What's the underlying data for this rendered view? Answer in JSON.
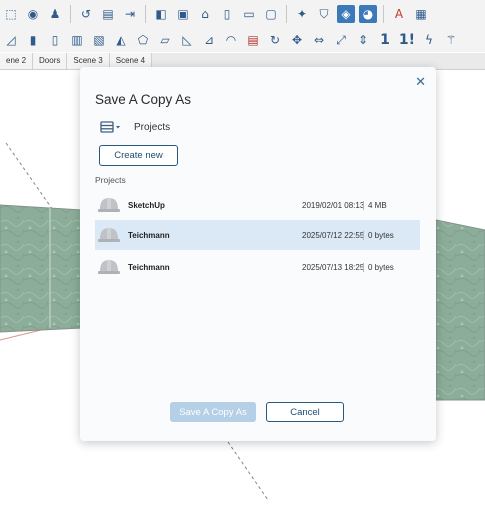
{
  "toolbar_top": {
    "icons": [
      "select-icon",
      "eye-icon",
      "walk-icon",
      "orbit-icon",
      "doc-icon",
      "arrow-icon",
      "cube-icon",
      "box-icon",
      "house-icon",
      "doc2-icon",
      "doc3-icon",
      "square-icon",
      "compass-icon",
      "shield-icon",
      "active-cube-icon",
      "active-cube2-icon",
      "text-icon",
      "swatch-icon"
    ]
  },
  "toolbar_second": {
    "icons": [
      "stair-icon",
      "door-icon",
      "door2-icon",
      "panel-icon",
      "panel2-icon",
      "roof-icon",
      "roof2-icon",
      "slab-icon",
      "beam-icon",
      "fold-icon",
      "curve-icon",
      "window-icon",
      "rotate-icon",
      "move-icon",
      "flip-icon",
      "scale-icon",
      "height-icon",
      "one-icon",
      "one-bang-icon",
      "bolt-icon",
      "wand-icon"
    ],
    "labels": {
      "one": "1",
      "one_bang": "1!"
    }
  },
  "scene_tabs": [
    "ene 2",
    "Doors",
    "Scene 3",
    "Scene 4"
  ],
  "dialog": {
    "title": "Save A Copy As",
    "location": "Projects",
    "create_new": "Create new",
    "section_label": "Projects",
    "files": [
      {
        "name": "SketchUp",
        "date": "2019/02/01 08:13",
        "size": "4 MB"
      },
      {
        "name": "Teichmann",
        "date": "2025/07/12 22:55",
        "size": "0 bytes"
      },
      {
        "name": "Teichmann",
        "date": "2025/07/13 18:25",
        "size": "0 bytes"
      }
    ],
    "save_label": "Save A Copy As",
    "cancel_label": "Cancel"
  },
  "colors": {
    "accent": "#28577f",
    "selected_row": "#dbe9f6",
    "save_disabled": "#b5cfe6",
    "toolbar_icon": "#2f5a8a",
    "marble": "#2f6b47"
  }
}
